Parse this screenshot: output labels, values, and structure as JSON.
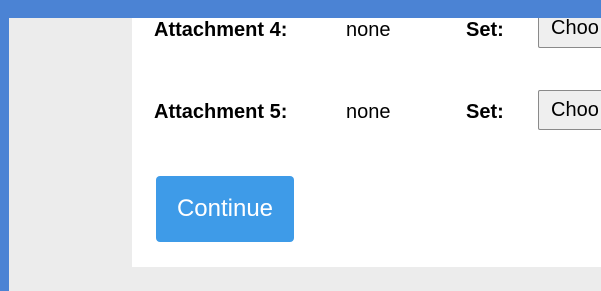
{
  "attachments": [
    {
      "label": "Attachment 4:",
      "value": "none",
      "set_label": "Set:",
      "select_value": "Choo"
    },
    {
      "label": "Attachment 5:",
      "value": "none",
      "set_label": "Set:",
      "select_value": "Choo"
    }
  ],
  "actions": {
    "continue_label": "Continue"
  },
  "colors": {
    "frame": "#4b83d4",
    "page_background": "#ececec",
    "panel_background": "#ffffff",
    "primary_button": "#3e9be8"
  }
}
